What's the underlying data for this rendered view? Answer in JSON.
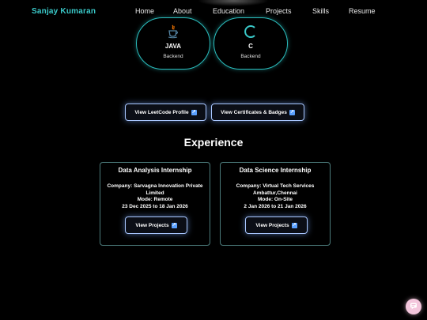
{
  "nav": {
    "brand": "Sanjay Kumaran",
    "links": [
      "Home",
      "About",
      "Education",
      "Projects",
      "Skills",
      "Resume"
    ],
    "brand_color": "#3ac9c9"
  },
  "skills": [
    {
      "name": "JAVA",
      "category": "Backend",
      "icon": "java-icon"
    },
    {
      "name": "C",
      "category": "Backend",
      "icon": "c-language-icon"
    }
  ],
  "buttons": {
    "leetcode": "View LeetCode Profile",
    "certificates": "View Certificates & Badges"
  },
  "experience": {
    "title": "Experience",
    "items": [
      {
        "title": "Data Analysis Internship",
        "company": "Company: Sarvagna Innovation Private Limited",
        "mode": "Mode: Remote",
        "dates": "23 Dec 2025 to 18 Jan 2026",
        "button": "View Projects"
      },
      {
        "title": "Data Science Internship",
        "company": "Company: Virtual Tech Services Ambattur,Chennai",
        "mode": "Mode: On-Site",
        "dates": "2 Jan 2026 to 21 Jan 2026",
        "button": "View Projects"
      }
    ]
  },
  "colors": {
    "accent": "#2bbfbf",
    "button_border": "#a9c7ff",
    "chat_bubble": "#f3c6dc"
  }
}
